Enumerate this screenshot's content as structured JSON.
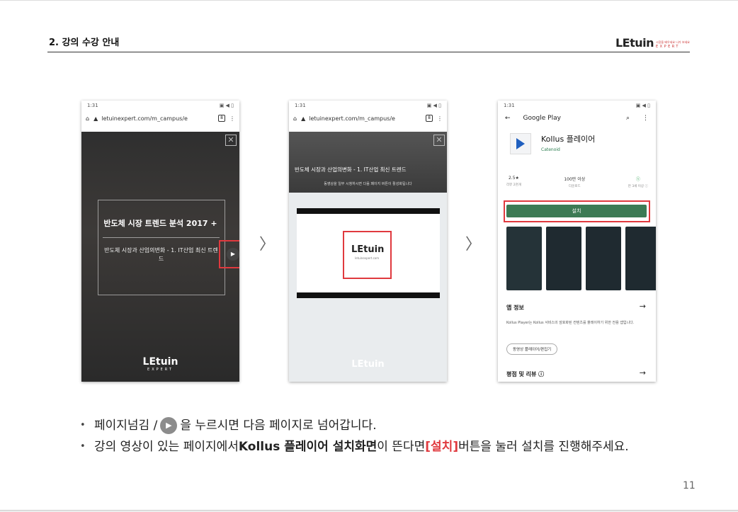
{
  "header": {
    "title": "2. 강의 수강 안내",
    "logo_main": "LEtuin",
    "logo_tagline": "시장을 배우세요 나가 보세요",
    "logo_sub": "EXPERT"
  },
  "phone1": {
    "status_time": "1:31",
    "status_icons": "▣ ◀ ▯",
    "url": "letuinexpert.com/m_campus/e",
    "tab_count": "8",
    "course_title": "반도체 시장 트렌드 분석 2017 +",
    "course_subtitle": "반도체 시장과 산업의변화 - 1. IT산업 최신 트렌드",
    "play_glyph": "▶",
    "close_glyph": "✕",
    "logo": "LEtuin",
    "logo_sub": "EXPERT"
  },
  "phone2": {
    "status_time": "1:31",
    "url": "letuinexpert.com/m_campus/e",
    "tab_count": "8",
    "lecture_title": "반도체 시장과 산업의변화 - 1. IT산업 최신 트렌드",
    "notice": "동영상을 일부 시청하시면 다음 페이지 버튼이 활성화됩니다",
    "video_logo": "LEtuin",
    "video_logo_sub": "letuinexpert.com",
    "close_glyph": "✕",
    "logo": "LEtuin"
  },
  "phone3": {
    "status_time": "1:31",
    "store": "Google Play",
    "app_name": "Kollus 플레이어",
    "developer": "Catenoid",
    "rating": "2.5★",
    "rating_label": "리뷰 2천개",
    "downloads": "100만 이상",
    "downloads_label": "다운로드",
    "content_rating_label": "만 3세 이상 ⓘ",
    "install": "설치",
    "info_heading": "앱 정보",
    "description": "Kollus Player는 Kollus 서비스의 암호화된 컨텐츠를 플레이하기 위한 전용 앱입니다.",
    "category_chip": "동영상 플레이어/편집기",
    "ratings_heading": "평점 및 리뷰 ⓘ"
  },
  "instructions": {
    "line1_before": "페이지넘김 / ",
    "line1_after": " 을 누르시면 다음 페이지로 넘어갑니다.",
    "line2_a": "강의 영상이 있는 페이지에서 ",
    "line2_bold": "Kollus 플레이어 설치화면",
    "line2_b": "이 뜬다면 ",
    "line2_red": "[설치]",
    "line2_c": "버튼을 눌러 설치를 진행해주세요."
  },
  "page_number": "11",
  "colors": {
    "highlight_red": "#e0393e",
    "install_green": "#3c7a54"
  }
}
